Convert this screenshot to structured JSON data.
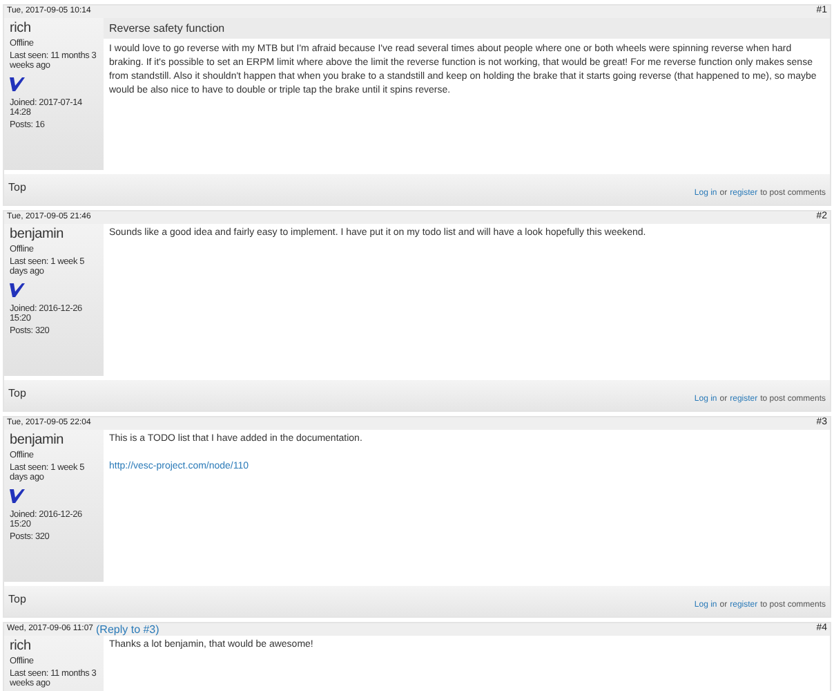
{
  "posts": [
    {
      "date": "Tue, 2017-09-05 10:14",
      "number": "#1",
      "author": {
        "name": "rich",
        "status": "Offline",
        "last_seen": "Last seen: 11 months 3 weeks ago",
        "badge": true,
        "joined": "Joined: 2017-07-14 14:28",
        "posts": "Posts: 16"
      },
      "title": "Reverse safety function",
      "body": [
        {
          "kind": "text",
          "text": "I would love to go reverse with my MTB but I'm afraid because I've read several times about people where one or both wheels were spinning reverse when hard braking. If it's possible to set an ERPM limit where above the limit the reverse function is not working, that would be great! For me reverse function only makes sense from standstill. Also it shouldn't happen that when you brake to a standstill and keep on holding the brake that it starts going reverse (that happened to me), so maybe would be also nice to have to double or triple tap the brake until it spins reverse."
        }
      ],
      "footer": {
        "top": "Top",
        "login": "Log in",
        "or": "or",
        "register": "register",
        "suffix": "to post comments"
      }
    },
    {
      "date": "Tue, 2017-09-05 21:46",
      "number": "#2",
      "author": {
        "name": "benjamin",
        "status": "Offline",
        "last_seen": "Last seen: 1 week 5 days ago",
        "badge": true,
        "joined": "Joined: 2016-12-26 15:20",
        "posts": "Posts: 320"
      },
      "body": [
        {
          "kind": "text",
          "text": "Sounds like a good idea and fairly easy to implement. I have put it on my todo list and will have a look hopefully this weekend."
        }
      ],
      "footer": {
        "top": "Top",
        "login": "Log in",
        "or": "or",
        "register": "register",
        "suffix": "to post comments"
      }
    },
    {
      "date": "Tue, 2017-09-05 22:04",
      "number": "#3",
      "author": {
        "name": "benjamin",
        "status": "Offline",
        "last_seen": "Last seen: 1 week 5 days ago",
        "badge": true,
        "joined": "Joined: 2016-12-26 15:20",
        "posts": "Posts: 320"
      },
      "body": [
        {
          "kind": "text",
          "text": "This is a TODO list that I have added in the documentation."
        },
        {
          "kind": "link",
          "text": "http://vesc-project.com/node/110"
        }
      ],
      "footer": {
        "top": "Top",
        "login": "Log in",
        "or": "or",
        "register": "register",
        "suffix": "to post comments"
      }
    },
    {
      "date": "Wed, 2017-09-06 11:07",
      "reply_to": "(Reply to #3)",
      "number": "#4",
      "author": {
        "name": "rich",
        "status": "Offline",
        "last_seen": "Last seen: 11 months 3 weeks ago"
      },
      "body": [
        {
          "kind": "text",
          "text": "Thanks a lot benjamin, that would be awesome!"
        }
      ]
    }
  ]
}
